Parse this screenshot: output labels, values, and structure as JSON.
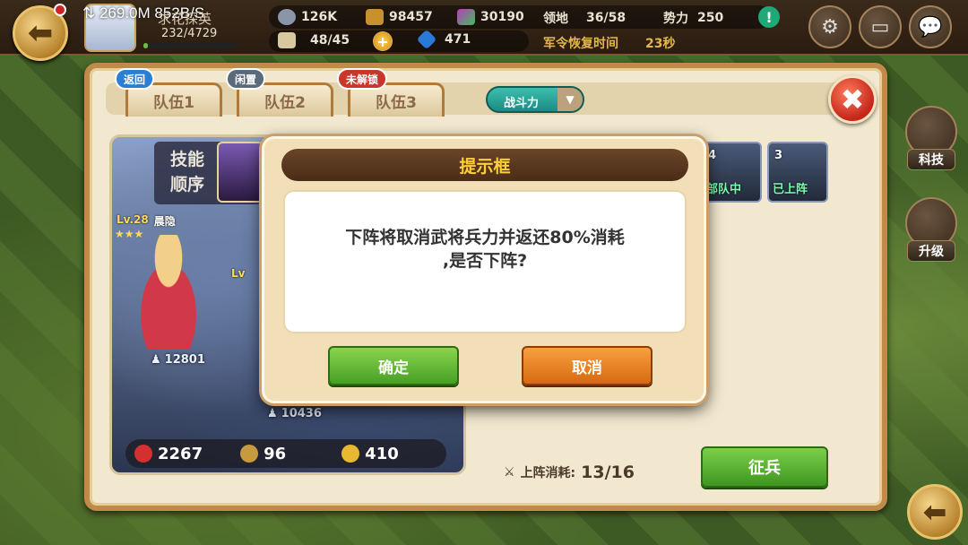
{
  "status_bar": {
    "speed": "⇅ 269.0M 852B/S"
  },
  "player": {
    "name": "求花探英",
    "exp": "232/4729",
    "exp_fraction": 0.05
  },
  "resources": {
    "iron": "126K",
    "wood": "98457",
    "gems": "30190",
    "territory_label": "领地",
    "territory_value": "36/58",
    "power_label": "势力",
    "power_value": "250",
    "stamina": "48/45",
    "crystal": "471",
    "recovery_label": "军令恢复时间",
    "recovery_value": "23秒"
  },
  "tabs": [
    {
      "label": "队伍1",
      "badge": "返回",
      "badge_color": "#2a7fd4"
    },
    {
      "label": "队伍2",
      "badge": "闲置",
      "badge_color": "#5a6a7a"
    },
    {
      "label": "队伍3",
      "badge": "未解锁",
      "badge_color": "#c8382a"
    }
  ],
  "sort": {
    "label": "战斗力"
  },
  "skill_order": {
    "label_line1": "技能",
    "label_line2": "顺序"
  },
  "heroes": [
    {
      "level": "Lv.28",
      "name": "晨隐",
      "power": "12801"
    },
    {
      "level": "Lv",
      "power": "10436"
    }
  ],
  "formation_stats": {
    "hp": "2267",
    "attack": "96",
    "defense": "410"
  },
  "team_cards": [
    {
      "num": "4",
      "label": "部队中"
    },
    {
      "num": "3",
      "label": "已上阵"
    }
  ],
  "deploy_cost": {
    "label": "上阵消耗:",
    "value": "13/16"
  },
  "recruit_button": "征兵",
  "side_buttons": {
    "tech": "科技",
    "upgrade": "升级"
  },
  "dialog": {
    "title": "提示框",
    "message_line1": "下阵将取消武将兵力并返还80%消耗",
    "message_line2": ",是否下阵?",
    "confirm": "确定",
    "cancel": "取消"
  }
}
